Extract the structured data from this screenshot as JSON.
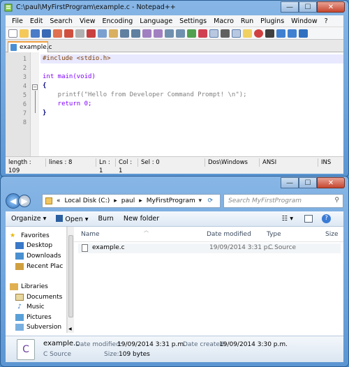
{
  "notepad": {
    "title": "C:\\paul\\MyFirstProgram\\example.c - Notepad++",
    "caption": {
      "minimize": "—",
      "maximize": "☐",
      "close": "✕"
    },
    "menu": [
      "File",
      "Edit",
      "Search",
      "View",
      "Encoding",
      "Language",
      "Settings",
      "Macro",
      "Run",
      "Plugins",
      "Window",
      "?"
    ],
    "tab_label": "example.c",
    "lines": [
      {
        "n": "1",
        "text": "#include <stdio.h>"
      },
      {
        "n": "2",
        "text": ""
      },
      {
        "n": "3",
        "text": "int main(void)"
      },
      {
        "n": "4",
        "text": "{"
      },
      {
        "n": "5",
        "text": "    printf(\"Hello from Developer Command Prompt! \\n\");"
      },
      {
        "n": "6",
        "text": "    return 0;"
      },
      {
        "n": "7",
        "text": "}"
      },
      {
        "n": "8",
        "text": ""
      }
    ],
    "status": {
      "length": "length : 109",
      "lines": "lines : 8",
      "ln": "Ln : 1",
      "col": "Col : 1",
      "sel": "Sel : 0",
      "eol": "Dos\\Windows",
      "enc": "ANSI",
      "mode": "INS"
    }
  },
  "explorer": {
    "caption": {
      "minimize": "—",
      "maximize": "☐",
      "close": "✕"
    },
    "breadcrumb": [
      "«",
      "Local Disk (C:)",
      "▸",
      "paul",
      "▸",
      "MyFirstProgram"
    ],
    "search_placeholder": "Search MyFirstProgram",
    "commands": {
      "organize": "Organize ▾",
      "open": "Open ▾",
      "burn": "Burn",
      "new_folder": "New folder"
    },
    "nav": {
      "favorites": "Favorites",
      "fav_items": [
        "Desktop",
        "Downloads",
        "Recent Plac"
      ],
      "libraries": "Libraries",
      "lib_items": [
        "Documents",
        "Music",
        "Pictures",
        "Subversion"
      ]
    },
    "columns": {
      "name": "Name",
      "date": "Date modified",
      "type": "Type",
      "size": "Size"
    },
    "files": [
      {
        "name": "example.c",
        "date": "19/09/2014 3:31 p...",
        "type": "C Source"
      }
    ],
    "details": {
      "name": "example.c",
      "type": "C Source",
      "modified_label": "Date modified:",
      "modified": "19/09/2014 3:31 p.m.",
      "created_label": "Date created:",
      "created": "19/09/2014 3:30 p.m.",
      "size_label": "Size:",
      "size": "109 bytes"
    }
  }
}
